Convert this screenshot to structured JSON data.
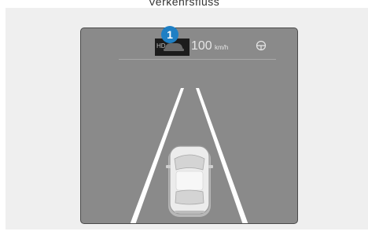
{
  "page": {
    "heading": "Verkehrsfluss"
  },
  "cluster": {
    "hda_label": "HD",
    "set_speed": "100",
    "speed_unit": "km/h",
    "callout_number": "1",
    "callout_color": "#1e7fc4",
    "screen_color": "#8a8a8a",
    "lane_line_color": "#ffffff",
    "icons": {
      "vehicle_distance": "car-outline-icon",
      "steering": "steering-wheel-icon"
    }
  }
}
